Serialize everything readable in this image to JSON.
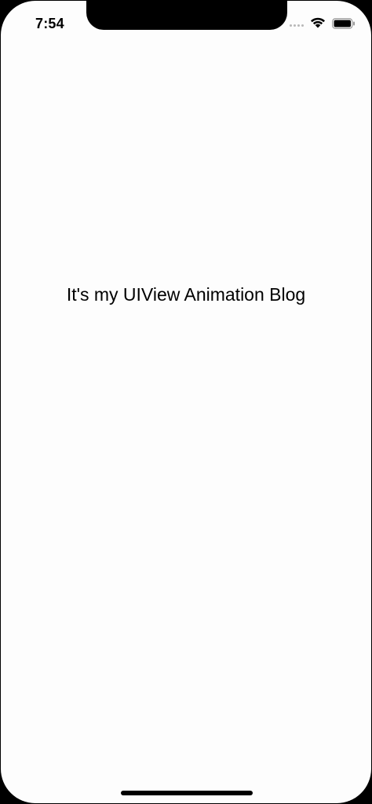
{
  "status_bar": {
    "time": "7:54"
  },
  "main": {
    "label": "It's my UIView Animation Blog"
  },
  "icons": {
    "wifi": "wifi-icon",
    "battery": "battery-icon",
    "signal": "cellular-signal-icon"
  },
  "colors": {
    "background": "#fdfdfd",
    "text": "#000000",
    "bezel": "#000000"
  }
}
